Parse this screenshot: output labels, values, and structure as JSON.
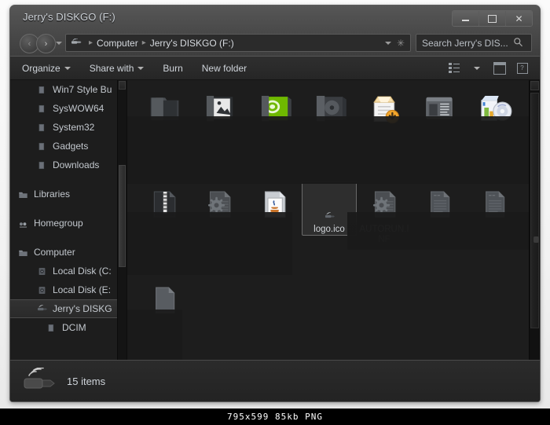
{
  "window": {
    "title": "Jerry's DISKGO (F:)",
    "buttons": {
      "minimize": "–",
      "maximize": "□",
      "close": "✕"
    }
  },
  "address": {
    "back_label": "‹",
    "forward_label": "›",
    "drive_icon": "usb-drive-icon",
    "crumbs": [
      "Computer",
      "Jerry's DISKGO (F:)"
    ],
    "separator": "▸",
    "refresh_label": "✳"
  },
  "search": {
    "placeholder": "Search Jerry's DIS...",
    "icon": "magnifier-icon"
  },
  "toolbar": {
    "items": [
      {
        "label": "Organize",
        "caret": true
      },
      {
        "label": "Share with",
        "caret": true
      },
      {
        "label": "Burn",
        "caret": false
      },
      {
        "label": "New folder",
        "caret": false
      }
    ],
    "right_icons": [
      "view-options-icon",
      "view-caret-icon",
      "preview-pane-icon",
      "help-icon"
    ],
    "help_glyph": "?"
  },
  "sidebar": {
    "items": [
      {
        "label": "Win7 Style Bu",
        "icon": "folder-small-icon",
        "indent": 1,
        "selected": false
      },
      {
        "label": "SysWOW64",
        "icon": "folder-small-icon",
        "indent": 1,
        "selected": false
      },
      {
        "label": "System32",
        "icon": "folder-small-icon",
        "indent": 1,
        "selected": false
      },
      {
        "label": "Gadgets",
        "icon": "folder-small-icon",
        "indent": 1,
        "selected": false
      },
      {
        "label": "Downloads",
        "icon": "folder-small-icon",
        "indent": 1,
        "selected": false
      },
      {
        "label": "Libraries",
        "icon": "libraries-icon",
        "indent": 0,
        "selected": false,
        "gap_before": true
      },
      {
        "label": "Homegroup",
        "icon": "homegroup-icon",
        "indent": 0,
        "selected": false,
        "gap_before": true
      },
      {
        "label": "Computer",
        "icon": "computer-icon",
        "indent": 0,
        "selected": false,
        "gap_before": true
      },
      {
        "label": "Local Disk (C:",
        "icon": "hard-disk-icon",
        "indent": 1,
        "selected": false
      },
      {
        "label": "Local Disk (E:",
        "icon": "hard-disk-icon",
        "indent": 1,
        "selected": false
      },
      {
        "label": "Jerry's DISKG",
        "icon": "usb-drive-icon",
        "indent": 1,
        "selected": true
      },
      {
        "label": "DCIM",
        "icon": "folder-small-icon",
        "indent": 2,
        "selected": false
      }
    ]
  },
  "files": [
    {
      "name": "",
      "icon": "folder-icon",
      "label_hidden": true,
      "selected": false
    },
    {
      "name": "",
      "icon": "folder-image-icon",
      "label_hidden": true,
      "selected": false
    },
    {
      "name": "",
      "icon": "folder-nvidia-icon",
      "label_hidden": true,
      "selected": false
    },
    {
      "name": "",
      "icon": "folder-disc-icon",
      "label_hidden": true,
      "selected": false
    },
    {
      "name": "",
      "icon": "installer-package-icon",
      "label_hidden": true,
      "selected": false
    },
    {
      "name": "",
      "icon": "console-window-icon",
      "label_hidden": true,
      "selected": false
    },
    {
      "name": "",
      "icon": "software-disc-icon",
      "label_hidden": true,
      "selected": false
    },
    {
      "name": "",
      "icon": "zip-archive-icon",
      "label_hidden": true,
      "selected": false
    },
    {
      "name": "",
      "icon": "gear-config-icon",
      "label_hidden": true,
      "selected": false
    },
    {
      "name": "",
      "icon": "java-file-icon",
      "label_hidden": true,
      "selected": false
    },
    {
      "name": "logo.ico",
      "icon": "usb-drive-icon",
      "label_hidden": false,
      "selected": true
    },
    {
      "name": "AUTORUN.INF",
      "icon": "gear-config-icon",
      "label_hidden": false,
      "selected": false
    },
    {
      "name": "",
      "icon": "text-file-icon",
      "label_hidden": true,
      "selected": false
    },
    {
      "name": "",
      "icon": "text-file-icon",
      "label_hidden": true,
      "selected": false
    },
    {
      "name": "",
      "icon": "blank-file-icon",
      "label_hidden": true,
      "selected": false
    }
  ],
  "status": {
    "icon": "usb-drive-large-icon",
    "text": "15 items"
  },
  "caption": {
    "text": "795x599 85kb PNG"
  },
  "colors": {
    "frame": "#4b4b4b",
    "content_bg": "#1d1d1d",
    "text": "#cfd4da",
    "selection_border": "#6a6a6a",
    "page_bg": "#f4f4f4"
  }
}
